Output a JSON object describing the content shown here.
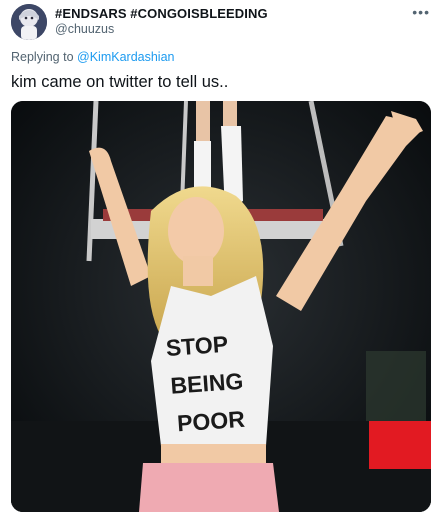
{
  "tweet": {
    "display_name": "#ENDSARS #CONGOISBLEEDING",
    "handle": "@chuuzus",
    "more_icon": "more-icon",
    "reply_prefix": "Replying to",
    "reply_mention": "@KimKardashian",
    "text": "kim came on twitter to tell us..",
    "colors": {
      "link": "#1d9bf0",
      "secondary": "#536471",
      "primary": "#0f1419"
    }
  },
  "media": {
    "shirt_lines": [
      "STOP",
      "BEING",
      "POOR"
    ]
  }
}
